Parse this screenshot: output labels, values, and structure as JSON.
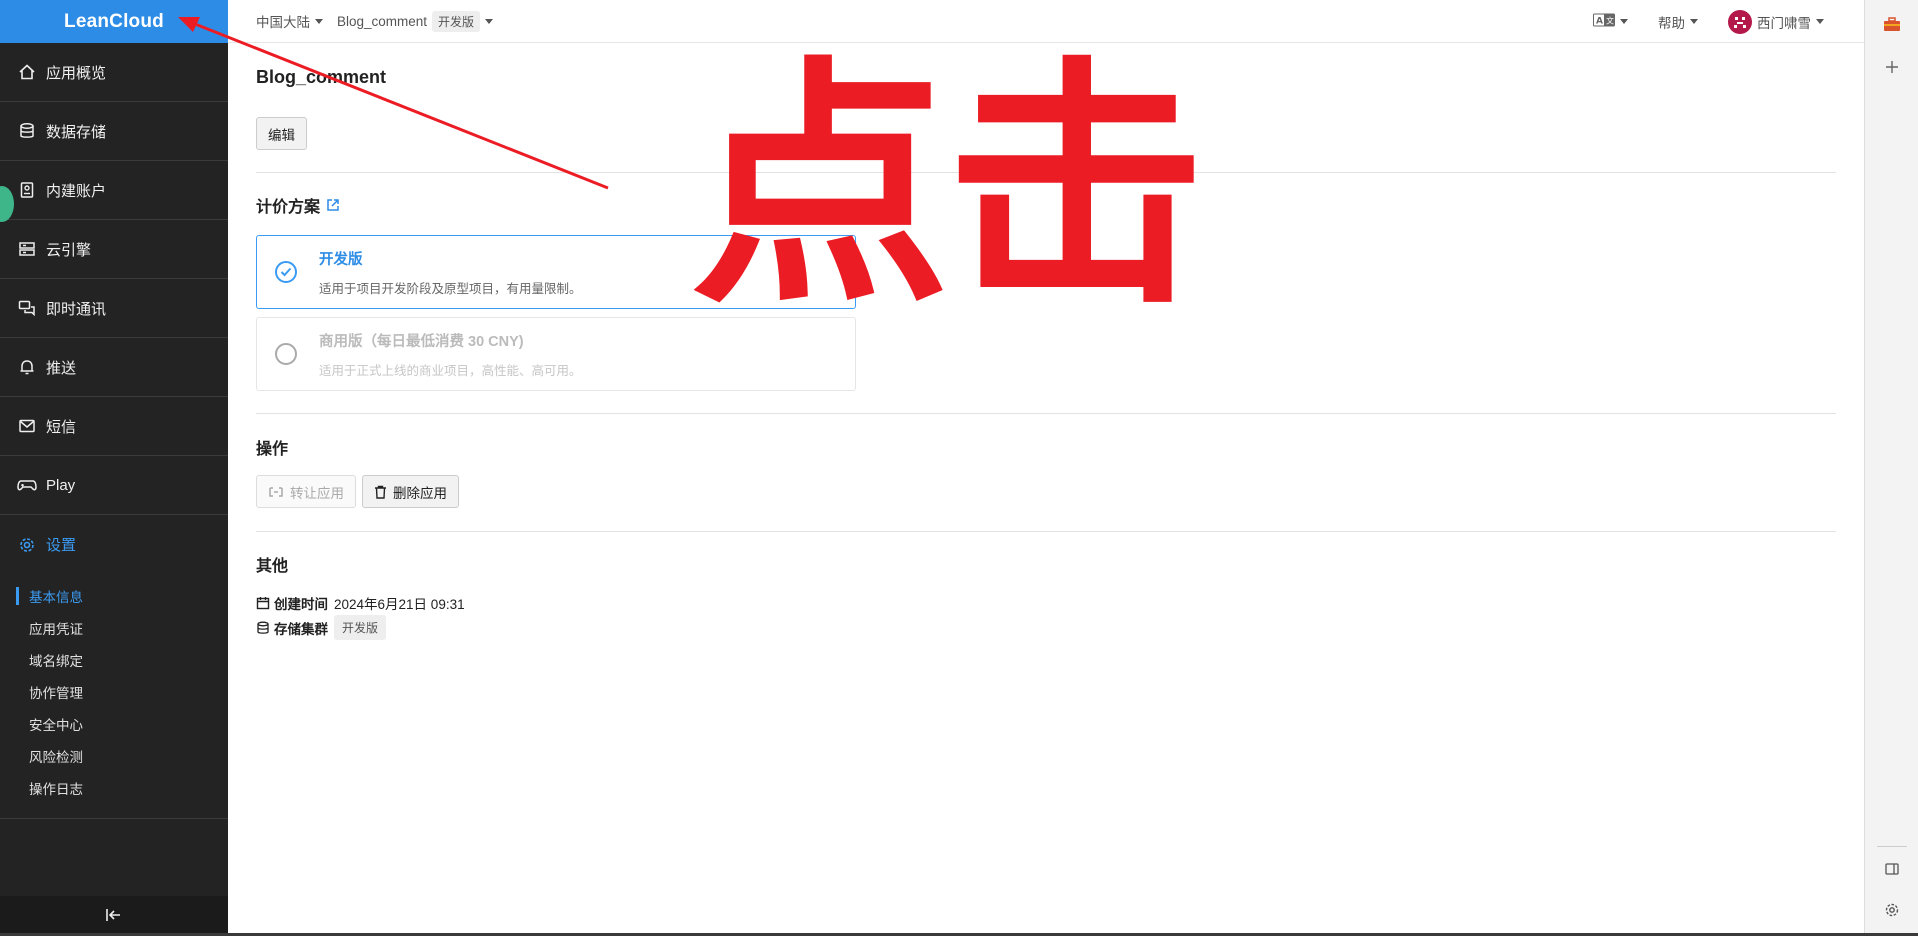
{
  "sidebar": {
    "logo": "LeanCloud",
    "items": [
      {
        "label": "应用概览",
        "icon": "home-icon"
      },
      {
        "label": "数据存储",
        "icon": "database-icon"
      },
      {
        "label": "内建账户",
        "icon": "account-icon"
      },
      {
        "label": "云引擎",
        "icon": "server-icon"
      },
      {
        "label": "即时通讯",
        "icon": "chat-icon"
      },
      {
        "label": "推送",
        "icon": "bell-icon"
      },
      {
        "label": "短信",
        "icon": "mail-icon"
      },
      {
        "label": "Play",
        "icon": "gamepad-icon"
      },
      {
        "label": "设置",
        "icon": "gear-icon",
        "active": true
      }
    ],
    "sub_items": [
      {
        "label": "基本信息",
        "active": true
      },
      {
        "label": "应用凭证"
      },
      {
        "label": "域名绑定"
      },
      {
        "label": "协作管理"
      },
      {
        "label": "安全中心"
      },
      {
        "label": "风险检测"
      },
      {
        "label": "操作日志"
      }
    ]
  },
  "topbar": {
    "region": "中国大陆",
    "app_name": "Blog_comment",
    "app_plan_tag": "开发版",
    "help": "帮助",
    "user": "西门啸雪"
  },
  "main": {
    "app_title": "Blog_comment",
    "edit_button": "编辑",
    "pricing_title": "计价方案",
    "plans": [
      {
        "name": "开发版",
        "desc": "适用于项目开发阶段及原型项目，有用量限制。",
        "selected": true
      },
      {
        "name": "商用版（每日最低消费 30 CNY)",
        "desc": "适用于正式上线的商业项目，高性能、高可用。",
        "selected": false
      }
    ],
    "ops_title": "操作",
    "transfer_button": "转让应用",
    "delete_button": "删除应用",
    "other_title": "其他",
    "created_label": "创建时间",
    "created_value": "2024年6月21日 09:31",
    "cluster_label": "存储集群",
    "cluster_value": "开发版"
  },
  "annotation": {
    "text": "点击",
    "color": "#ec1c24"
  },
  "colors": {
    "accent": "#2d8ce6",
    "sidebar_bg": "#232323"
  }
}
